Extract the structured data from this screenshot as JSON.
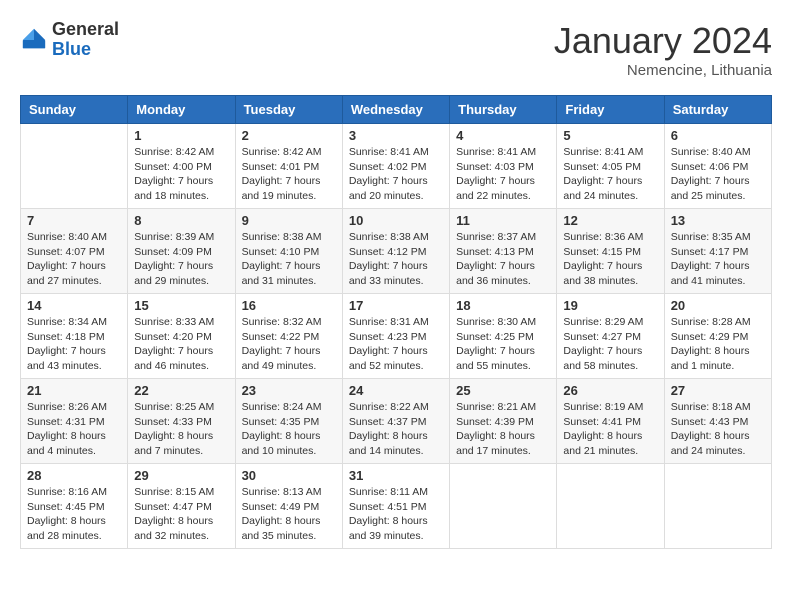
{
  "header": {
    "logo_general": "General",
    "logo_blue": "Blue",
    "month_year": "January 2024",
    "location": "Nemencine, Lithuania"
  },
  "days_of_week": [
    "Sunday",
    "Monday",
    "Tuesday",
    "Wednesday",
    "Thursday",
    "Friday",
    "Saturday"
  ],
  "weeks": [
    [
      {
        "day": "",
        "sunrise": "",
        "sunset": "",
        "daylight": ""
      },
      {
        "day": "1",
        "sunrise": "Sunrise: 8:42 AM",
        "sunset": "Sunset: 4:00 PM",
        "daylight": "Daylight: 7 hours and 18 minutes."
      },
      {
        "day": "2",
        "sunrise": "Sunrise: 8:42 AM",
        "sunset": "Sunset: 4:01 PM",
        "daylight": "Daylight: 7 hours and 19 minutes."
      },
      {
        "day": "3",
        "sunrise": "Sunrise: 8:41 AM",
        "sunset": "Sunset: 4:02 PM",
        "daylight": "Daylight: 7 hours and 20 minutes."
      },
      {
        "day": "4",
        "sunrise": "Sunrise: 8:41 AM",
        "sunset": "Sunset: 4:03 PM",
        "daylight": "Daylight: 7 hours and 22 minutes."
      },
      {
        "day": "5",
        "sunrise": "Sunrise: 8:41 AM",
        "sunset": "Sunset: 4:05 PM",
        "daylight": "Daylight: 7 hours and 24 minutes."
      },
      {
        "day": "6",
        "sunrise": "Sunrise: 8:40 AM",
        "sunset": "Sunset: 4:06 PM",
        "daylight": "Daylight: 7 hours and 25 minutes."
      }
    ],
    [
      {
        "day": "7",
        "sunrise": "Sunrise: 8:40 AM",
        "sunset": "Sunset: 4:07 PM",
        "daylight": "Daylight: 7 hours and 27 minutes."
      },
      {
        "day": "8",
        "sunrise": "Sunrise: 8:39 AM",
        "sunset": "Sunset: 4:09 PM",
        "daylight": "Daylight: 7 hours and 29 minutes."
      },
      {
        "day": "9",
        "sunrise": "Sunrise: 8:38 AM",
        "sunset": "Sunset: 4:10 PM",
        "daylight": "Daylight: 7 hours and 31 minutes."
      },
      {
        "day": "10",
        "sunrise": "Sunrise: 8:38 AM",
        "sunset": "Sunset: 4:12 PM",
        "daylight": "Daylight: 7 hours and 33 minutes."
      },
      {
        "day": "11",
        "sunrise": "Sunrise: 8:37 AM",
        "sunset": "Sunset: 4:13 PM",
        "daylight": "Daylight: 7 hours and 36 minutes."
      },
      {
        "day": "12",
        "sunrise": "Sunrise: 8:36 AM",
        "sunset": "Sunset: 4:15 PM",
        "daylight": "Daylight: 7 hours and 38 minutes."
      },
      {
        "day": "13",
        "sunrise": "Sunrise: 8:35 AM",
        "sunset": "Sunset: 4:17 PM",
        "daylight": "Daylight: 7 hours and 41 minutes."
      }
    ],
    [
      {
        "day": "14",
        "sunrise": "Sunrise: 8:34 AM",
        "sunset": "Sunset: 4:18 PM",
        "daylight": "Daylight: 7 hours and 43 minutes."
      },
      {
        "day": "15",
        "sunrise": "Sunrise: 8:33 AM",
        "sunset": "Sunset: 4:20 PM",
        "daylight": "Daylight: 7 hours and 46 minutes."
      },
      {
        "day": "16",
        "sunrise": "Sunrise: 8:32 AM",
        "sunset": "Sunset: 4:22 PM",
        "daylight": "Daylight: 7 hours and 49 minutes."
      },
      {
        "day": "17",
        "sunrise": "Sunrise: 8:31 AM",
        "sunset": "Sunset: 4:23 PM",
        "daylight": "Daylight: 7 hours and 52 minutes."
      },
      {
        "day": "18",
        "sunrise": "Sunrise: 8:30 AM",
        "sunset": "Sunset: 4:25 PM",
        "daylight": "Daylight: 7 hours and 55 minutes."
      },
      {
        "day": "19",
        "sunrise": "Sunrise: 8:29 AM",
        "sunset": "Sunset: 4:27 PM",
        "daylight": "Daylight: 7 hours and 58 minutes."
      },
      {
        "day": "20",
        "sunrise": "Sunrise: 8:28 AM",
        "sunset": "Sunset: 4:29 PM",
        "daylight": "Daylight: 8 hours and 1 minute."
      }
    ],
    [
      {
        "day": "21",
        "sunrise": "Sunrise: 8:26 AM",
        "sunset": "Sunset: 4:31 PM",
        "daylight": "Daylight: 8 hours and 4 minutes."
      },
      {
        "day": "22",
        "sunrise": "Sunrise: 8:25 AM",
        "sunset": "Sunset: 4:33 PM",
        "daylight": "Daylight: 8 hours and 7 minutes."
      },
      {
        "day": "23",
        "sunrise": "Sunrise: 8:24 AM",
        "sunset": "Sunset: 4:35 PM",
        "daylight": "Daylight: 8 hours and 10 minutes."
      },
      {
        "day": "24",
        "sunrise": "Sunrise: 8:22 AM",
        "sunset": "Sunset: 4:37 PM",
        "daylight": "Daylight: 8 hours and 14 minutes."
      },
      {
        "day": "25",
        "sunrise": "Sunrise: 8:21 AM",
        "sunset": "Sunset: 4:39 PM",
        "daylight": "Daylight: 8 hours and 17 minutes."
      },
      {
        "day": "26",
        "sunrise": "Sunrise: 8:19 AM",
        "sunset": "Sunset: 4:41 PM",
        "daylight": "Daylight: 8 hours and 21 minutes."
      },
      {
        "day": "27",
        "sunrise": "Sunrise: 8:18 AM",
        "sunset": "Sunset: 4:43 PM",
        "daylight": "Daylight: 8 hours and 24 minutes."
      }
    ],
    [
      {
        "day": "28",
        "sunrise": "Sunrise: 8:16 AM",
        "sunset": "Sunset: 4:45 PM",
        "daylight": "Daylight: 8 hours and 28 minutes."
      },
      {
        "day": "29",
        "sunrise": "Sunrise: 8:15 AM",
        "sunset": "Sunset: 4:47 PM",
        "daylight": "Daylight: 8 hours and 32 minutes."
      },
      {
        "day": "30",
        "sunrise": "Sunrise: 8:13 AM",
        "sunset": "Sunset: 4:49 PM",
        "daylight": "Daylight: 8 hours and 35 minutes."
      },
      {
        "day": "31",
        "sunrise": "Sunrise: 8:11 AM",
        "sunset": "Sunset: 4:51 PM",
        "daylight": "Daylight: 8 hours and 39 minutes."
      },
      {
        "day": "",
        "sunrise": "",
        "sunset": "",
        "daylight": ""
      },
      {
        "day": "",
        "sunrise": "",
        "sunset": "",
        "daylight": ""
      },
      {
        "day": "",
        "sunrise": "",
        "sunset": "",
        "daylight": ""
      }
    ]
  ]
}
